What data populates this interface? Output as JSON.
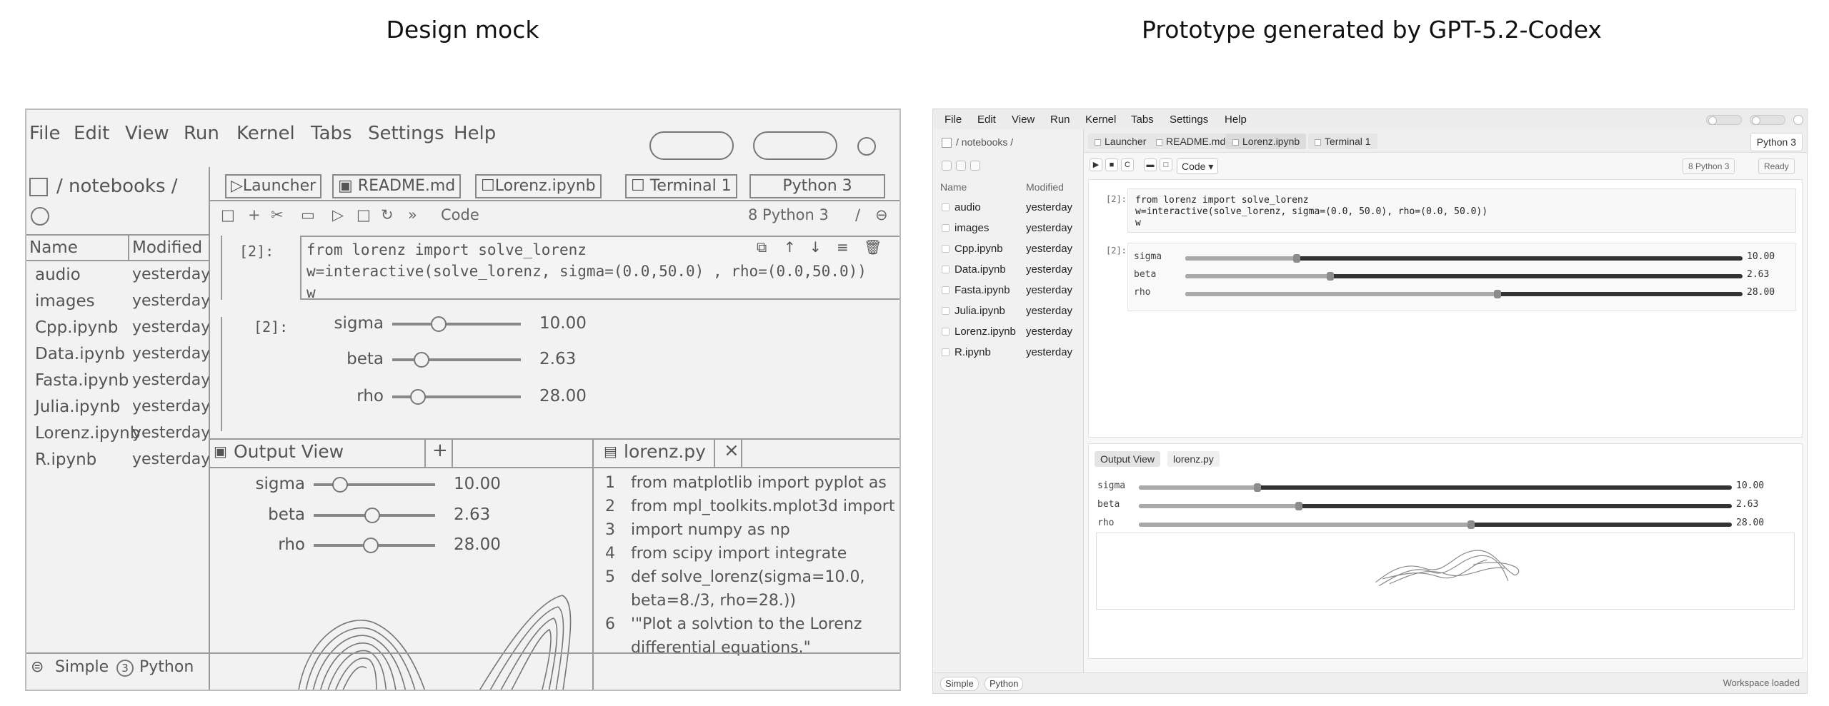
{
  "headings": {
    "left": "Design mock",
    "right": "Prototype generated by GPT-5.2-Codex"
  },
  "mock": {
    "menu": [
      "File",
      "Edit",
      "View",
      "Run",
      "Kernel",
      "Tabs",
      "Settings",
      "Help"
    ],
    "breadcrumb": "/ notebooks /",
    "columns": {
      "name": "Name",
      "modified": "Modified"
    },
    "files": [
      {
        "name": "audio",
        "modified": "yesterday"
      },
      {
        "name": "images",
        "modified": "yesterday"
      },
      {
        "name": "Cpp.ipynb",
        "modified": "yesterday"
      },
      {
        "name": "Data.ipynb",
        "modified": "yesterday"
      },
      {
        "name": "Fasta.ipynb",
        "modified": "yesterday"
      },
      {
        "name": "Julia.ipynb",
        "modified": "yesterday"
      },
      {
        "name": "Lorenz.ipynb",
        "modified": "yesterday"
      },
      {
        "name": "R.ipynb",
        "modified": "yesterday"
      }
    ],
    "tabs": [
      "Launcher",
      "README.md",
      "Lorenz.ipynb",
      "Terminal 1"
    ],
    "kernel_tab": "Python 3",
    "toolbar": {
      "cell_type": "Code",
      "kernel": "8 Python 3"
    },
    "cell_prompt": "[2]:",
    "output_prompt": "[2]:",
    "code_lines": [
      "from lorenz import solve_lorenz",
      "w=interactive(solve_lorenz, sigma=(0.0,50.0) , rho=(0.0,50.0))",
      "w"
    ],
    "sliders": [
      {
        "label": "sigma",
        "value": "10.00",
        "fraction": 0.36
      },
      {
        "label": "beta",
        "value": "2.63",
        "fraction": 0.23
      },
      {
        "label": "rho",
        "value": "28.00",
        "fraction": 0.2
      }
    ],
    "output_view": {
      "title": "Output View",
      "add": "+"
    },
    "lorenz_file": {
      "title": "lorenz.py",
      "close": "×",
      "lines": [
        {
          "no": "1",
          "text": "from matplotlib import pyplot as"
        },
        {
          "no": "2",
          "text": "from mpl_toolkits.mplot3d import"
        },
        {
          "no": "3",
          "text": "import numpy as np"
        },
        {
          "no": "4",
          "text": "from scipy import integrate"
        },
        {
          "no": "5",
          "text": "def solve_lorenz(sigma=10.0,"
        },
        {
          "no": "",
          "text": "    beta=8./3, rho=28.))"
        },
        {
          "no": "6",
          "text": "'\"Plot a solvtion to the Lorenz"
        },
        {
          "no": "",
          "text": "   differential equations.\""
        }
      ]
    },
    "status": {
      "simple": "Simple",
      "python_count": "3",
      "python": "Python"
    }
  },
  "proto": {
    "menu": [
      "File",
      "Edit",
      "View",
      "Run",
      "Kernel",
      "Tabs",
      "Settings",
      "Help"
    ],
    "breadcrumb": "/ notebooks /",
    "columns": {
      "name": "Name",
      "modified": "Modified"
    },
    "files": [
      {
        "name": "audio",
        "modified": "yesterday"
      },
      {
        "name": "images",
        "modified": "yesterday"
      },
      {
        "name": "Cpp.ipynb",
        "modified": "yesterday"
      },
      {
        "name": "Data.ipynb",
        "modified": "yesterday"
      },
      {
        "name": "Fasta.ipynb",
        "modified": "yesterday"
      },
      {
        "name": "Julia.ipynb",
        "modified": "yesterday"
      },
      {
        "name": "Lorenz.ipynb",
        "modified": "yesterday"
      },
      {
        "name": "R.ipynb",
        "modified": "yesterday"
      }
    ],
    "tabs": [
      "Launcher",
      "README.md",
      "Lorenz.ipynb",
      "Terminal 1"
    ],
    "kernel_tab": "Python 3",
    "toolbar": {
      "cell_type": "Code ▾",
      "kernel_badge": "8 Python 3",
      "status_badge": "Ready"
    },
    "cell_prompt": "[2]:",
    "output_prompt": "[2]:",
    "code_lines": [
      "from lorenz import solve_lorenz",
      "w=interactive(solve_lorenz, sigma=(0.0, 50.0), rho=(0.0, 50.0))",
      "w"
    ],
    "sliders": [
      {
        "label": "sigma",
        "value": "10.00",
        "fraction": 0.2
      },
      {
        "label": "beta",
        "value": "2.63",
        "fraction": 0.26
      },
      {
        "label": "rho",
        "value": "28.00",
        "fraction": 0.56
      }
    ],
    "bottom_tabs": [
      "Output View",
      "lorenz.py"
    ],
    "bottom_sliders": [
      {
        "label": "sigma",
        "value": "10.00",
        "fraction": 0.2
      },
      {
        "label": "beta",
        "value": "2.63",
        "fraction": 0.27
      },
      {
        "label": "rho",
        "value": "28.00",
        "fraction": 0.56
      }
    ],
    "status": {
      "simple": "Simple",
      "python": "Python",
      "message": "Workspace loaded"
    }
  }
}
